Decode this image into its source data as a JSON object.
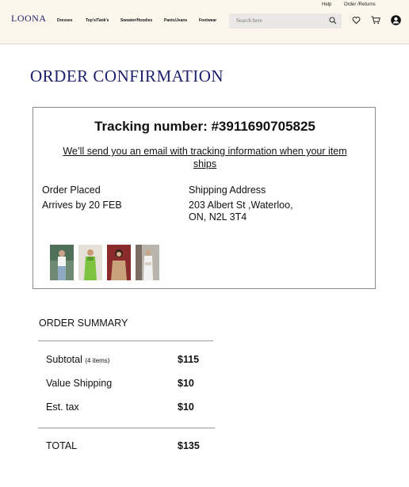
{
  "header": {
    "util_links": [
      "Help",
      "Order /Returns"
    ],
    "logo": "LOONA",
    "nav": [
      "Dresses",
      "Top's/Tank's",
      "Sweater/Hoodies",
      "Pants/Jeans",
      "Footwear"
    ],
    "search_placeholder": "Search here",
    "icons": [
      "search-icon",
      "heart-icon",
      "cart-icon",
      "user-icon"
    ]
  },
  "page": {
    "title": "ORDER CONFIRMATION"
  },
  "order": {
    "tracking": "Tracking number: #3911690705825",
    "email_note": "We’ll send you an email with tracking information when your item ships",
    "status": "Order Placed",
    "arrives": "Arrives by 20 FEB",
    "shipping_label": "Shipping Address",
    "address_line1": "203 Albert St ,Waterloo,",
    "address_line2": "ON, N2L 3T4",
    "thumbnails": [
      "product-thumbnail-1",
      "product-thumbnail-2",
      "product-thumbnail-3",
      "product-thumbnail-4"
    ]
  },
  "summary": {
    "title": "ORDER SUMMARY",
    "subtotal_label": "Subtotal",
    "subtotal_note": "(4 items)",
    "subtotal": "$115",
    "shipping_label": "Value Shipping",
    "shipping": "$10",
    "tax_label": "Est. tax",
    "tax": "$10",
    "total_label": "TOTAL",
    "total": "$135"
  },
  "colors": {
    "header_bg": "#fdf6ec",
    "brand": "#1c1f6b"
  }
}
